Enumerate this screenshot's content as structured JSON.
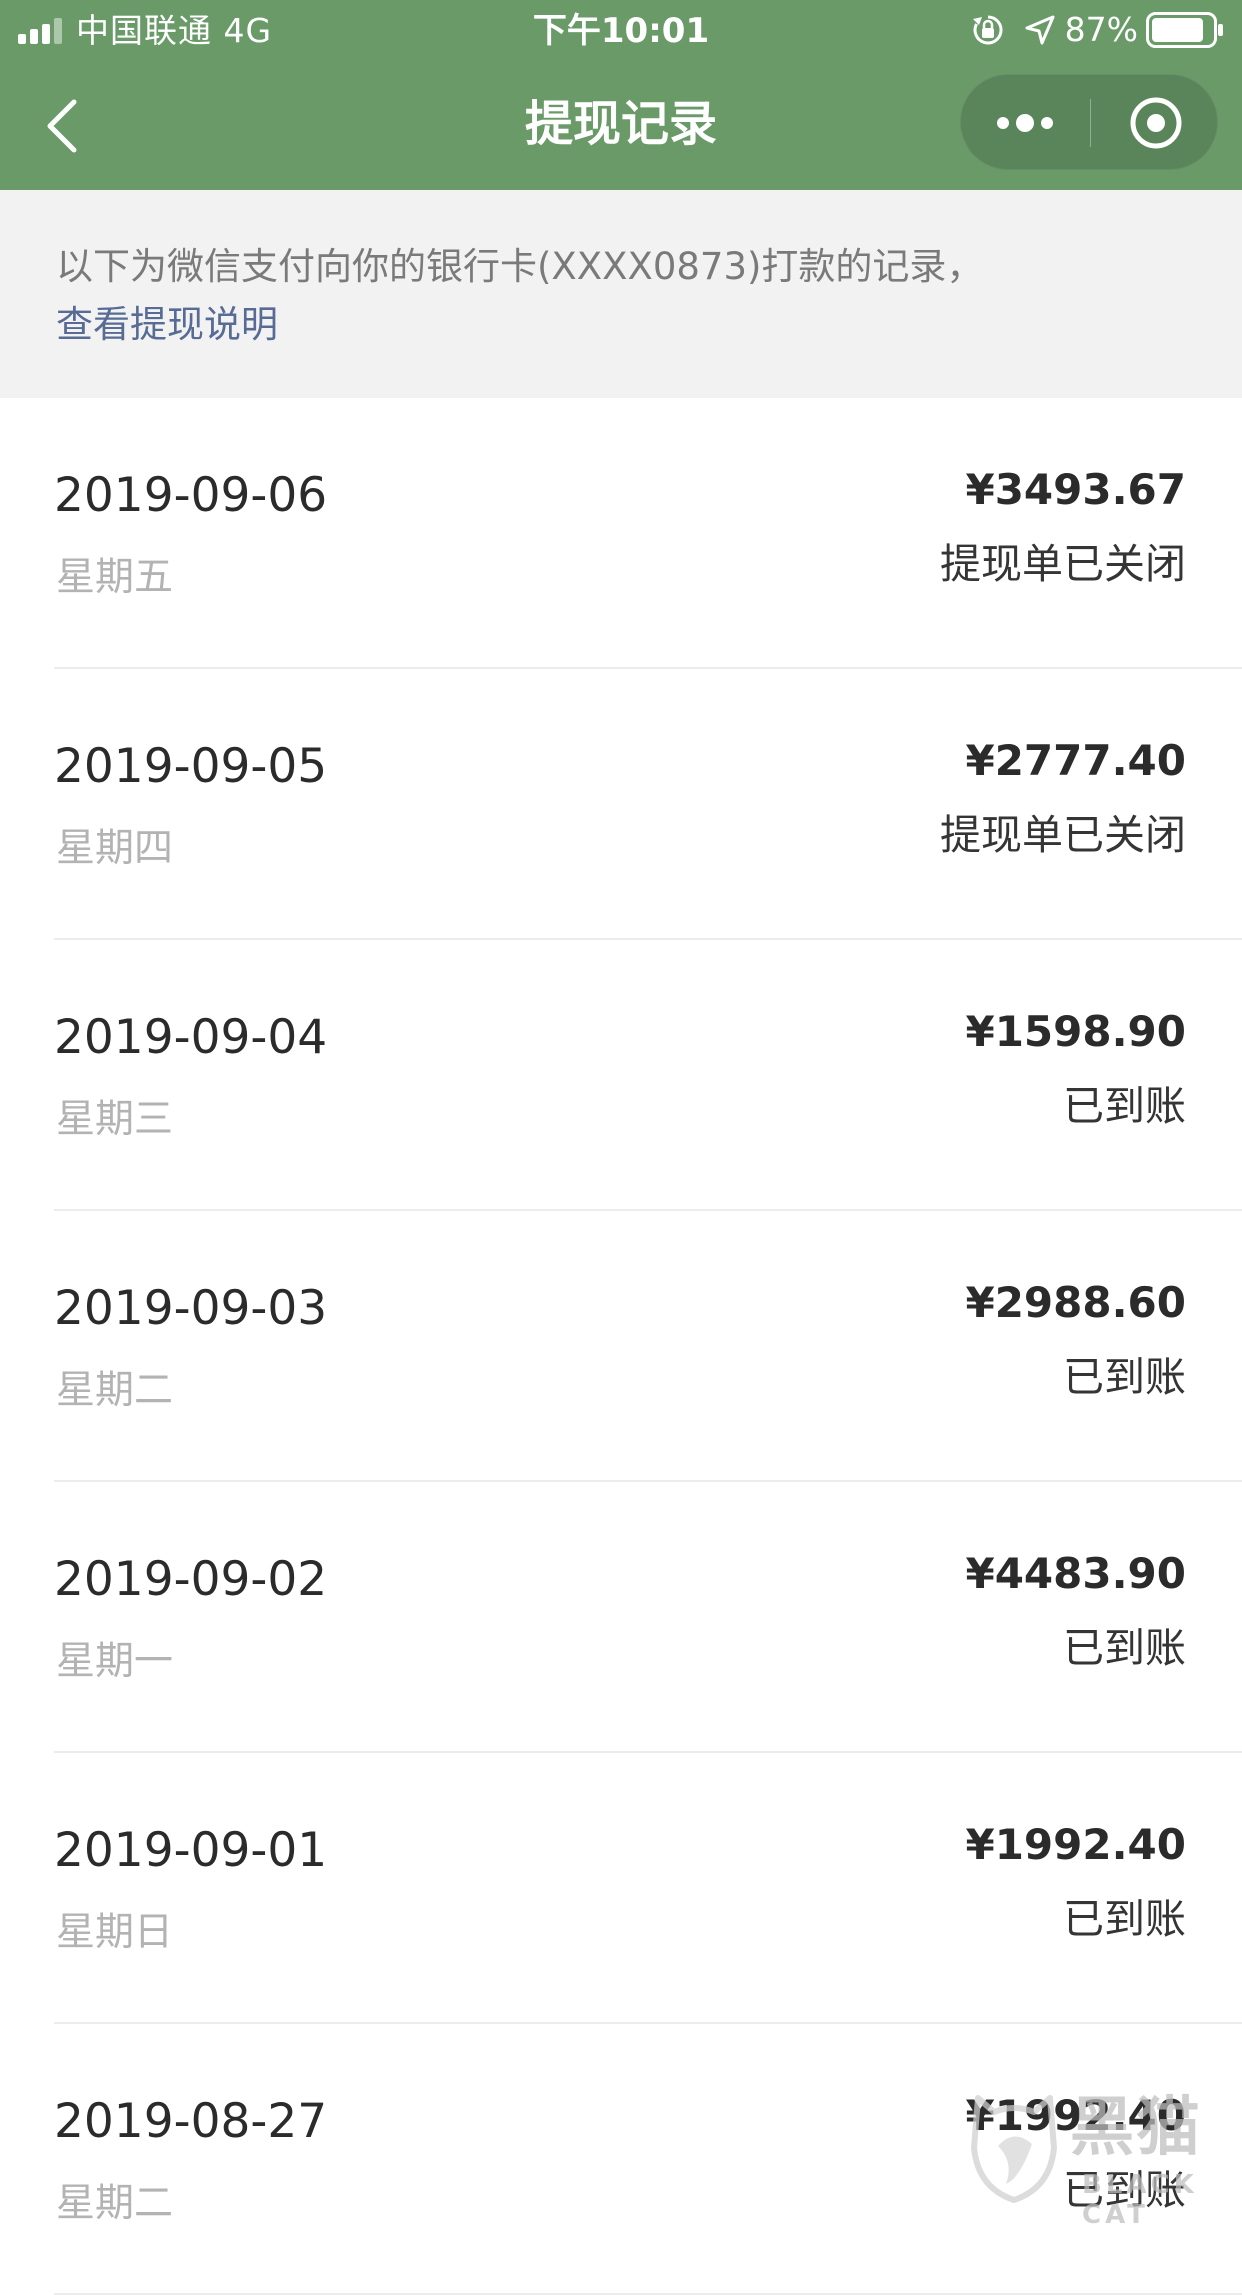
{
  "status_bar": {
    "carrier": "中国联通  4G",
    "time": "下午10:01",
    "battery": "87%",
    "battery_level": 0.87
  },
  "nav": {
    "title": "提现记录",
    "back_icon": "chevron-left-icon",
    "more_icon": "more-dots-icon",
    "close_icon": "target-close-icon"
  },
  "notice": {
    "text": "以下为微信支付向你的银行卡(XXXX0873)打款的记录，",
    "link": "查看提现说明"
  },
  "records": [
    {
      "date": "2019-09-06",
      "weekday": "星期五",
      "amount": "¥3493.67",
      "status": "提现单已关闭"
    },
    {
      "date": "2019-09-05",
      "weekday": "星期四",
      "amount": "¥2777.40",
      "status": "提现单已关闭"
    },
    {
      "date": "2019-09-04",
      "weekday": "星期三",
      "amount": "¥1598.90",
      "status": "已到账"
    },
    {
      "date": "2019-09-03",
      "weekday": "星期二",
      "amount": "¥2988.60",
      "status": "已到账"
    },
    {
      "date": "2019-09-02",
      "weekday": "星期一",
      "amount": "¥4483.90",
      "status": "已到账"
    },
    {
      "date": "2019-09-01",
      "weekday": "星期日",
      "amount": "¥1992.40",
      "status": "已到账"
    },
    {
      "date": "2019-08-27",
      "weekday": "星期二",
      "amount": "¥1992.40",
      "status": "已到账"
    }
  ],
  "watermark": {
    "text": "黑猫",
    "sub": "BLACK CAT"
  },
  "colors": {
    "nav_green": "#699a68",
    "link_blue": "#576b95",
    "notice_bg": "#f2f2f2",
    "secondary_text": "#b3b3b3"
  }
}
